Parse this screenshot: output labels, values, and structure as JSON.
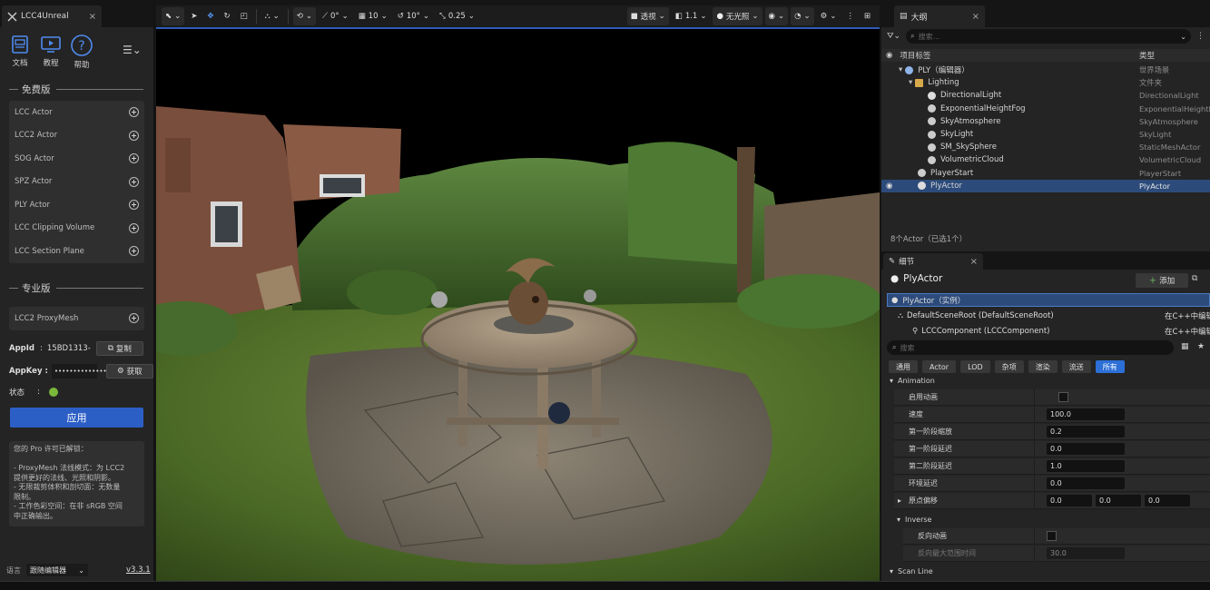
{
  "left": {
    "tab_title": "LCC4Unreal",
    "toolbar": [
      {
        "label": "文档",
        "icon": "document-icon"
      },
      {
        "label": "教程",
        "icon": "tutorial-icon"
      },
      {
        "label": "帮助",
        "icon": "help-icon"
      }
    ],
    "free_section": "免费版",
    "free_items": [
      "LCC Actor",
      "LCC2 Actor",
      "SOG Actor",
      "SPZ Actor",
      "PLY Actor",
      "LCC Clipping Volume",
      "LCC Section Plane"
    ],
    "pro_section": "专业版",
    "pro_items": [
      "LCC2 ProxyMesh"
    ],
    "appid_label": "AppId",
    "appid_value": "15BD1313-",
    "copy_label": "复制",
    "appkey_label": "AppKey :",
    "appkey_value": "•••••••••••••••",
    "fetch_label": "获取",
    "status_label": "状态",
    "status_colon": ":",
    "apply_label": "应用",
    "info_text": "您的 Pro 许可已解锁：\n\n- ProxyMesh 法线模式：为 LCC2\n提供更好的法线、光照和阴影。\n- 无限裁剪体积和剖切面：无数量\n限制。\n- 工作色彩空间：在非 sRGB 空间\n中正确输出。",
    "language_label": "语言",
    "language_value": "跟随编辑器",
    "version": "v3.3.1"
  },
  "viewport": {
    "toolbar": {
      "snap_translate": "0°",
      "grid_size": "10",
      "rotation_snap": "10°",
      "scale_snap": "0.25",
      "perspective": "透视",
      "camera_speed": "1.1",
      "lighting_mode": "无光照"
    }
  },
  "outliner": {
    "tab_title": "大纲",
    "search_placeholder": "搜索...",
    "col_label": "项目标签",
    "col_type": "类型",
    "rows": [
      {
        "label": "PLY（编辑器）",
        "type": "世界场景",
        "indent": 1,
        "icon": "world-icon",
        "selected": false
      },
      {
        "label": "Lighting",
        "type": "文件夹",
        "indent": 2,
        "icon": "folder-icon",
        "selected": false
      },
      {
        "label": "DirectionalLight",
        "type": "DirectionalLight",
        "indent": 3,
        "icon": "directional-light-icon",
        "selected": false
      },
      {
        "label": "ExponentialHeightFog",
        "type": "ExponentialHeightFog",
        "indent": 3,
        "icon": "fog-icon",
        "selected": false
      },
      {
        "label": "SkyAtmosphere",
        "type": "SkyAtmosphere",
        "indent": 3,
        "icon": "sky-atmosphere-icon",
        "selected": false
      },
      {
        "label": "SkyLight",
        "type": "SkyLight",
        "indent": 3,
        "icon": "sky-light-icon",
        "selected": false
      },
      {
        "label": "SM_SkySphere",
        "type": "StaticMeshActor",
        "indent": 3,
        "icon": "static-mesh-icon",
        "selected": false
      },
      {
        "label": "VolumetricCloud",
        "type": "VolumetricCloud",
        "indent": 3,
        "icon": "cloud-icon",
        "selected": false
      },
      {
        "label": "PlayerStart",
        "type": "PlayerStart",
        "indent": 2,
        "icon": "player-start-icon",
        "selected": false
      },
      {
        "label": "PlyActor",
        "type": "PlyActor",
        "indent": 2,
        "icon": "actor-icon",
        "selected": true
      }
    ],
    "actor_count": "8个Actor（已选1个）"
  },
  "details": {
    "tab_title": "细节",
    "actor_name": "PlyActor",
    "add_label": "添加",
    "components": [
      {
        "label": "PlyActor（实例）",
        "right": "",
        "selected": true
      },
      {
        "label": "DefaultSceneRoot (DefaultSceneRoot)",
        "right": "在C++中编辑",
        "selected": false
      },
      {
        "label": "LCCComponent (LCCComponent)",
        "right": "在C++中编辑",
        "selected": false
      }
    ],
    "search_placeholder": "搜索",
    "filters": [
      "通用",
      "Actor",
      "LOD",
      "杂项",
      "渲染",
      "流送",
      "所有"
    ],
    "active_filter": "所有",
    "sections": {
      "animation": "Animation",
      "inverse": "Inverse",
      "scanline": "Scan Line"
    },
    "props": {
      "enable_anim": "启用动画",
      "speed": "速度",
      "speed_val": "100.0",
      "stage1_scale": "第一阶段缩放",
      "stage1_scale_val": "0.2",
      "stage1_delay": "第一阶段延迟",
      "stage1_delay_val": "0.0",
      "stage2_delay": "第二阶段延迟",
      "stage2_delay_val": "1.0",
      "env_delay": "环境延迟",
      "env_delay_val": "0.0",
      "origin_offset": "原点偏移",
      "origin_x": "0.0",
      "origin_y": "0.0",
      "origin_z": "0.0",
      "reverse_anim": "反向动画",
      "reverse_max": "反向最大范围时间",
      "reverse_max_val": "30.0"
    }
  }
}
